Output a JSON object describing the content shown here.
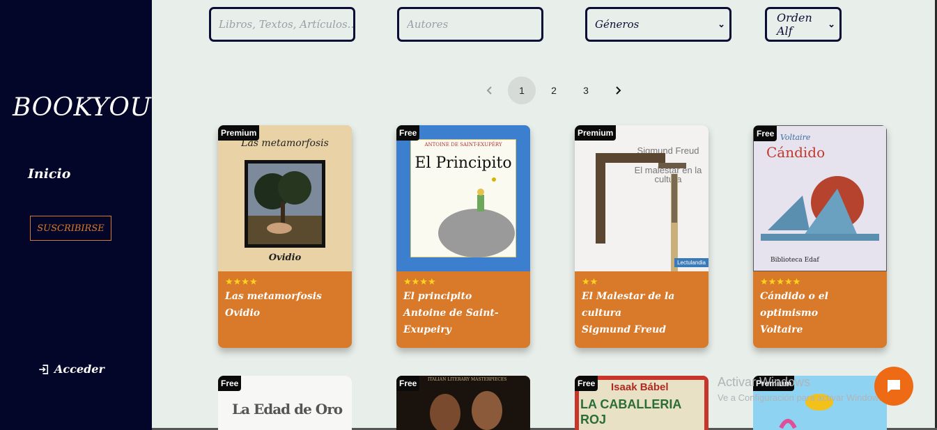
{
  "sidebar": {
    "brand": "BOOKYOU",
    "nav_home": "Inicio",
    "subscribe": "SUSCRIBIRSE",
    "login": "Acceder"
  },
  "filters": {
    "search_placeholder": "Libros, Textos, Artículos...",
    "authors_placeholder": "Autores",
    "genres": "Géneros",
    "order": "Orden Alf"
  },
  "pagination": {
    "prev_icon": "chevron-left-icon",
    "pages": [
      "1",
      "2",
      "3"
    ],
    "current": "1",
    "next_icon": "chevron-right-icon"
  },
  "books": [
    {
      "badge": "Premium",
      "stars": "★★★★",
      "rating": 4,
      "title": "Las metamorfosis",
      "author": "Ovidio",
      "cover_title": "Las metamorfosis",
      "cover_author": "Ovidio"
    },
    {
      "badge": "Free",
      "stars": "★★★★",
      "rating": 4,
      "title": "El principito",
      "author": "Antoine de Saint-Exupeiry",
      "cover_title": "El Principito",
      "cover_author": "ANTOINE DE SAINT-EXUPÉRY"
    },
    {
      "badge": "Premium",
      "stars": "★★",
      "rating": 2,
      "title": "El Malestar de la cultura",
      "author": "Sigmund Freud",
      "cover_author": "Sigmund Freud",
      "cover_title": "El malestar en la cultura",
      "cover_publisher": "Lectulandia"
    },
    {
      "badge": "Free",
      "stars": "★★★★★",
      "rating": 5,
      "title": "Cándido o el optimismo",
      "author": "Voltaire",
      "cover_author": "Voltaire",
      "cover_title": "Cándido",
      "cover_publisher": "Biblioteca Edaf"
    }
  ],
  "books_row2": [
    {
      "badge": "Free",
      "cover_text": "La Edad de Oro"
    },
    {
      "badge": "Free",
      "cover_text": "ITALIAN LITERARY MASTERPIECES"
    },
    {
      "badge": "Free",
      "cover_author": "Isaak Bábel",
      "cover_title": "LA CABALLERIA ROJ"
    },
    {
      "badge": "Premium"
    }
  ],
  "watermark": {
    "line1": "Activar Windows",
    "line2": "Ve a Configuración para activar Windows."
  },
  "colors": {
    "sidebar": "#030628",
    "accent": "#d97a2b",
    "background": "#e8eeea",
    "stars": "#ffd21e",
    "chat": "#ef6a15"
  }
}
